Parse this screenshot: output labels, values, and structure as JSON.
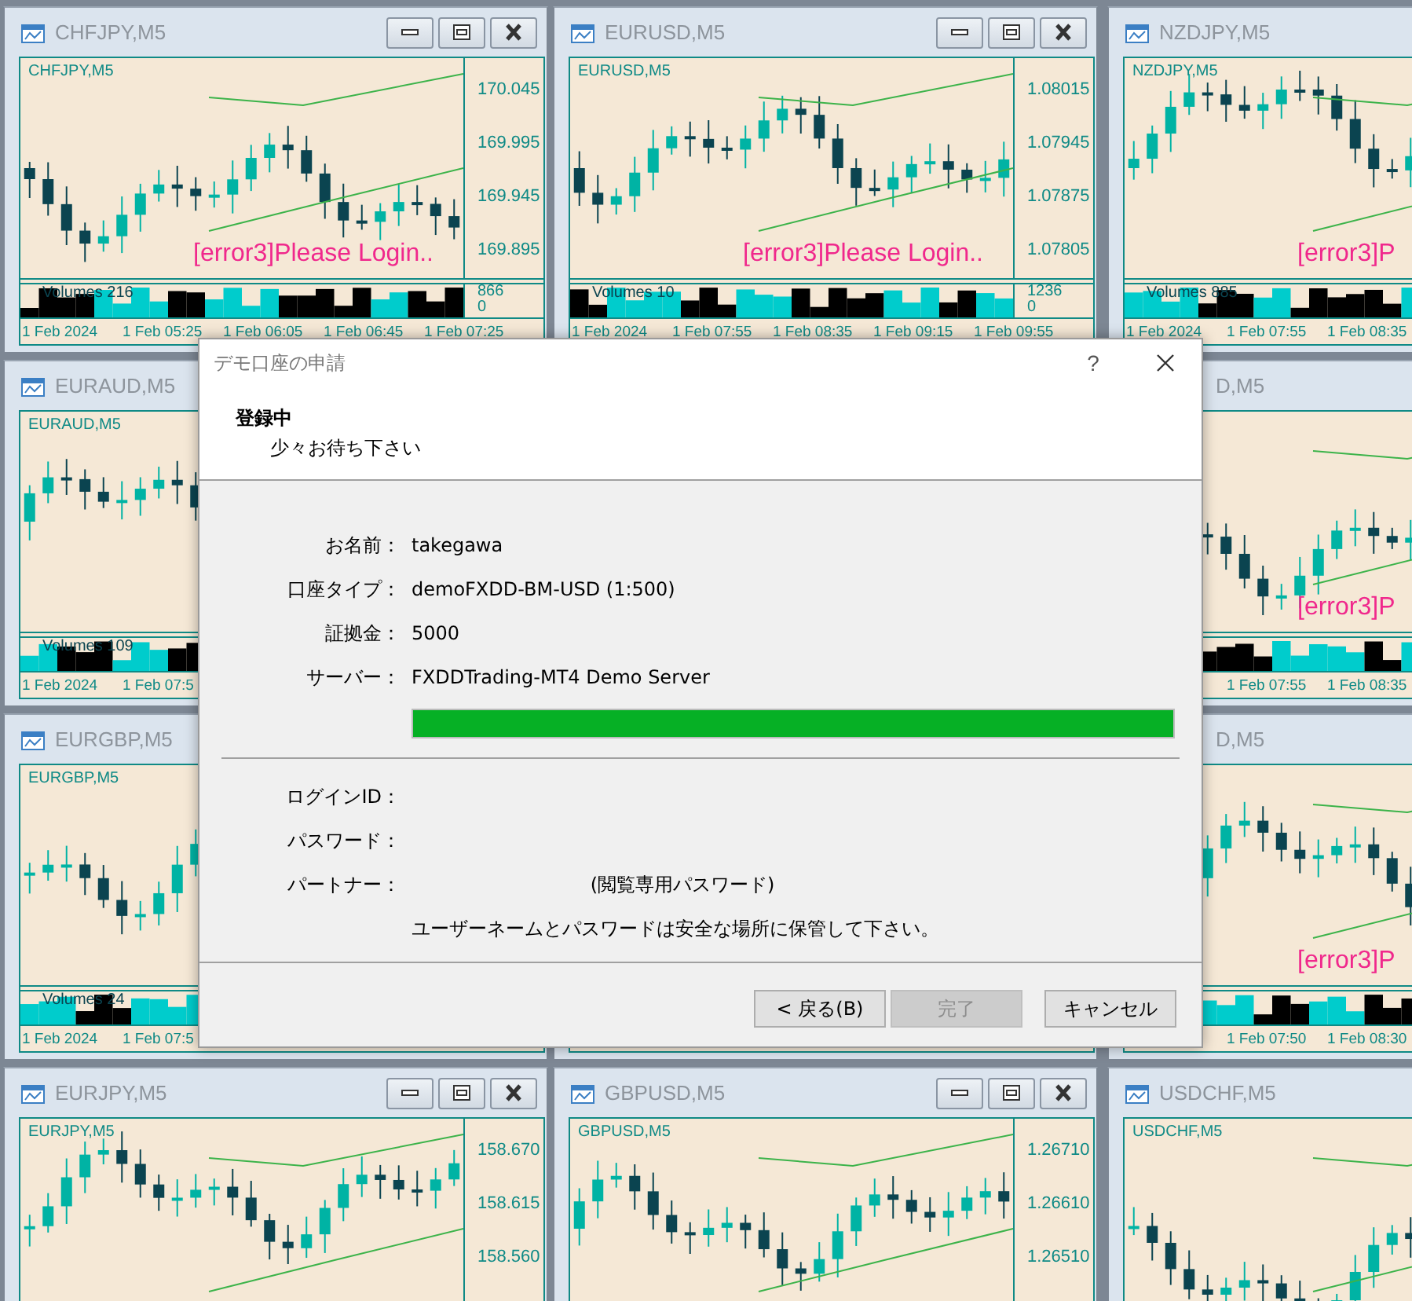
{
  "windows": [
    {
      "title": "CHFJPY,M5",
      "controls": true,
      "label": "CHFJPY,M5",
      "prices": [
        "170.045",
        "169.995",
        "169.945",
        "169.895"
      ],
      "error": "[error3]Please Login..",
      "volumes": "Volumes 216",
      "volume_scale": [
        "866",
        "0"
      ],
      "times": [
        "1 Feb 2024",
        "1 Feb 05:25",
        "1 Feb 06:05",
        "1 Feb 06:45",
        "1 Feb 07:25"
      ]
    },
    {
      "title": "EURUSD,M5",
      "controls": true,
      "label": "EURUSD,M5",
      "prices": [
        "1.08015",
        "1.07945",
        "1.07875",
        "1.07805"
      ],
      "error": "[error3]Please Login..",
      "volumes": "Volumes 10",
      "volume_scale": [
        "1236",
        "0"
      ],
      "times": [
        "1 Feb 2024",
        "1 Feb 07:55",
        "1 Feb 08:35",
        "1 Feb 09:15",
        "1 Feb 09:55"
      ]
    },
    {
      "title": "NZDJPY,M5",
      "label": "NZDJPY,M5",
      "error": "[error3]P",
      "volumes": "Volumes 885",
      "times": [
        "1 Feb 2024",
        "1 Feb 07:55",
        "1 Feb 08:35"
      ]
    },
    {
      "title": "EURAUD,M5",
      "label": "EURAUD,M5",
      "volumes": "Volumes 109",
      "times": [
        "1 Feb 2024",
        "1 Feb 07:5"
      ]
    },
    {
      "title": "D,M5",
      "error": "[error3]P",
      "times": [
        "1 Feb 07:55",
        "1 Feb 08:35"
      ]
    },
    {
      "title": "EURGBP,M5",
      "label": "EURGBP,M5",
      "volumes": "Volumes 24",
      "times": [
        "1 Feb 2024",
        "1 Feb 07:5"
      ]
    },
    {
      "title": "D,M5",
      "error": "[error3]P",
      "times": [
        "1 Feb 07:50",
        "1 Feb 08:30"
      ]
    },
    {
      "title": "EURJPY,M5",
      "controls": true,
      "label": "EURJPY,M5",
      "prices": [
        "158.670",
        "158.615",
        "158.560"
      ]
    },
    {
      "title": "GBPUSD,M5",
      "controls": true,
      "label": "GBPUSD,M5",
      "prices": [
        "1.26710",
        "1.26610",
        "1.26510"
      ]
    },
    {
      "title": "USDCHF,M5",
      "label": "USDCHF,M5"
    }
  ],
  "dialog": {
    "title": "デモ口座の申請",
    "help": "?",
    "heading": "登録中",
    "subheading": "少々お待ち下さい",
    "details": [
      {
        "label": "お名前：",
        "value": "takegawa"
      },
      {
        "label": "口座タイプ：",
        "value": "demoFXDD-BM-USD (1:500)"
      },
      {
        "label": "証拠金：",
        "value": "5000"
      },
      {
        "label": "サーバー：",
        "value": "FXDDTrading-MT4 Demo Server"
      }
    ],
    "progress": {
      "level": 1
    },
    "credentials": [
      {
        "label": "ログインID："
      },
      {
        "label": "パスワード："
      },
      {
        "label": "パートナー：",
        "value": "(閲覧専用パスワード)"
      }
    ],
    "note": "ユーザーネームとパスワードは安全な場所に保管して下さい。",
    "buttons": [
      {
        "label": "< 戻る(B)",
        "disabled": false
      },
      {
        "label": "完了",
        "disabled": true
      },
      {
        "label": "キャンセル",
        "disabled": false
      }
    ]
  }
}
